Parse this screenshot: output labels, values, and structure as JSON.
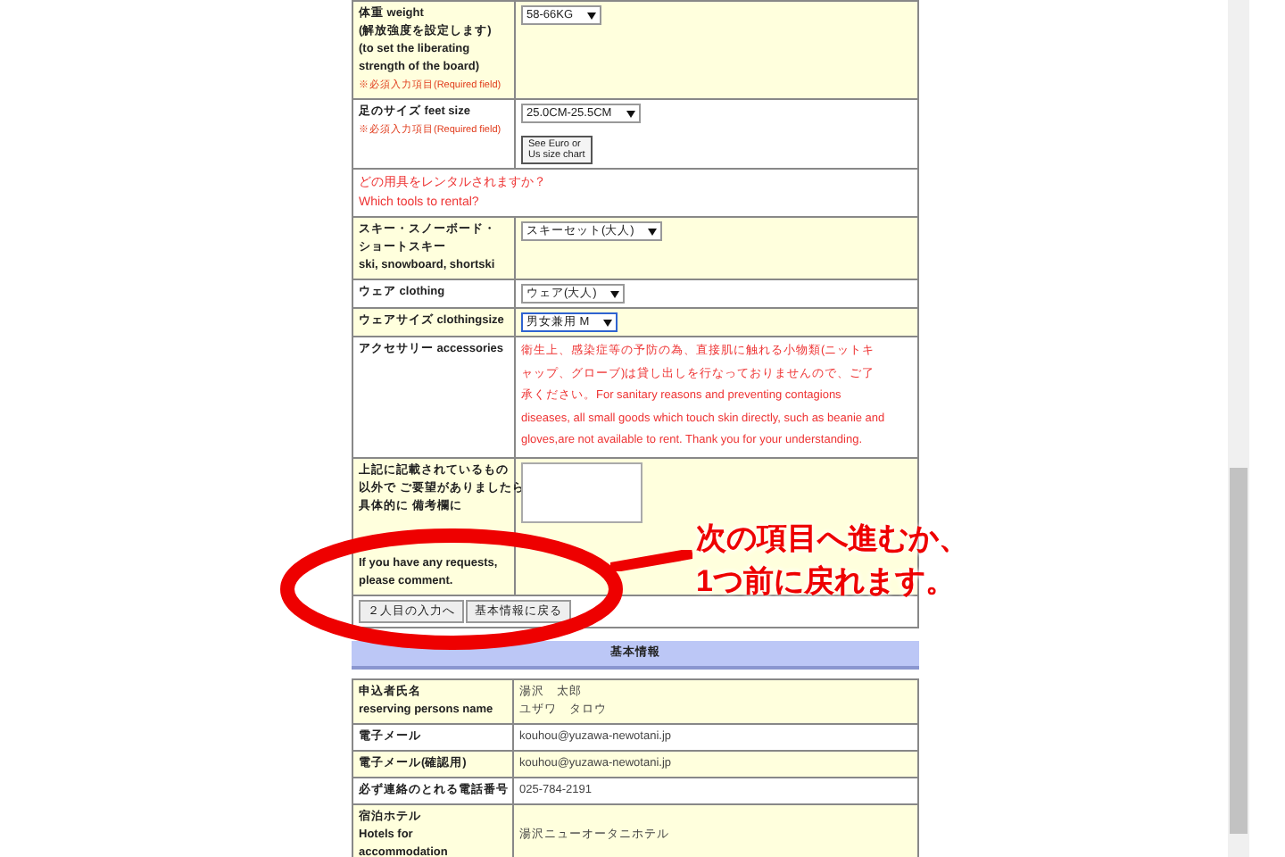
{
  "rental_form": {
    "rows": [
      {
        "kind": "select",
        "shaded": true,
        "label_lines": [
          "体重 weight",
          "(解放強度を設定します)",
          "(to set the liberating",
          "strength of the board)"
        ],
        "required": "※必須入力項目(Required field)",
        "value": "58-66KG",
        "focused": false
      },
      {
        "kind": "select_chart",
        "shaded": false,
        "label_lines": [
          "足のサイズ feet size"
        ],
        "required": "※必須入力項目(Required field)",
        "value": "25.0CM-25.5CM",
        "focused": false,
        "button_lines": [
          "See Euro or",
          "Us size chart"
        ]
      },
      {
        "kind": "question",
        "lines": [
          "どの用具をレンタルされますか？",
          "Which tools to rental?"
        ]
      },
      {
        "kind": "select",
        "shaded": true,
        "label_lines": [
          "スキー・スノーボード・",
          "ショートスキー",
          "ski, snowboard, shortski"
        ],
        "value": "スキーセット(大人)",
        "focused": false
      },
      {
        "kind": "select",
        "shaded": false,
        "label_lines": [
          "ウェア clothing"
        ],
        "value": "ウェア(大人)",
        "focused": false
      },
      {
        "kind": "select",
        "shaded": true,
        "label_lines": [
          "ウェアサイズ clothingsize"
        ],
        "value": "男女兼用 M",
        "focused": true
      },
      {
        "kind": "notice",
        "shaded": false,
        "label_lines": [
          "アクセサリー accessories"
        ],
        "notice": "衛生上、感染症等の予防の為、直接肌に触れる小物類(ニットキャップ、グローブ)は貸し出しを行なっておりませんので、ご了承ください。For sanitary reasons and preventing contagions diseases, all small goods which touch skin directly, such as beanie and gloves,are not available to rent. Thank you for your understanding."
      },
      {
        "kind": "textarea",
        "shaded": true,
        "label_lines": [
          "上記に記載されているもの",
          "以外で ご要望がありましたら",
          "具体的に 備考欄に",
          "If you have any requests,",
          "please comment."
        ]
      }
    ],
    "buttons": [
      "２人目の入力へ",
      "基本情報に戻る"
    ]
  },
  "basic_info": {
    "title": "基本情報",
    "rows": [
      {
        "shaded": true,
        "label_lines": [
          "申込者氏名",
          "reserving persons name"
        ],
        "value_lines": [
          "湯沢　太郎",
          "ユザワ　タロウ"
        ]
      },
      {
        "shaded": false,
        "label_lines": [
          "電子メール"
        ],
        "value_lines": [
          "kouhou@yuzawa-newotani.jp"
        ]
      },
      {
        "shaded": true,
        "label_lines": [
          "電子メール(確認用)"
        ],
        "value_lines": [
          "kouhou@yuzawa-newotani.jp"
        ]
      },
      {
        "shaded": false,
        "label_lines": [
          "必ず連絡のとれる電話番号"
        ],
        "value_lines": [
          "025-784-2191"
        ]
      },
      {
        "shaded": true,
        "label_lines": [
          "宿泊ホテル",
          "Hotels for",
          "accommodation"
        ],
        "value_lines": [
          "湯沢ニューオータニホテル"
        ]
      }
    ]
  },
  "callout": {
    "lines": [
      "次の項目へ進むか、",
      "1つ前に戻れます。"
    ]
  }
}
